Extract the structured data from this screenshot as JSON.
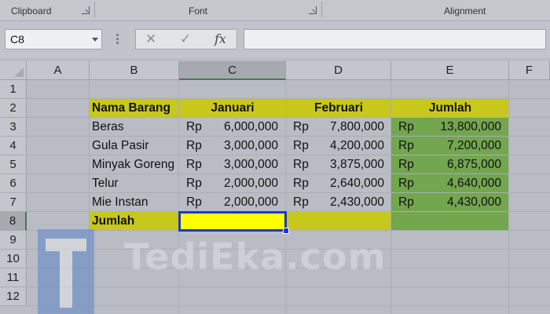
{
  "ribbon": {
    "groups": [
      {
        "label": "Clipboard"
      },
      {
        "label": "Font"
      },
      {
        "label": "Alignment"
      }
    ]
  },
  "formula_bar": {
    "name_box": "C8",
    "cancel_icon": "✕",
    "enter_icon": "✓",
    "fx_label": "fx",
    "formula": ""
  },
  "columns": [
    "A",
    "B",
    "C",
    "D",
    "E",
    "F"
  ],
  "rows": [
    "1",
    "2",
    "3",
    "4",
    "5",
    "6",
    "7",
    "8",
    "9",
    "10",
    "11",
    "12"
  ],
  "selected_cell": "C8",
  "table": {
    "headers": {
      "item": "Nama Barang",
      "jan": "Januari",
      "feb": "Februari",
      "total": "Jumlah"
    },
    "currency": "Rp",
    "rows": [
      {
        "item": "Beras",
        "jan": "6,000,000",
        "feb": "7,800,000",
        "total": "13,800,000"
      },
      {
        "item": "Gula Pasir",
        "jan": "3,000,000",
        "feb": "4,200,000",
        "total": "7,200,000"
      },
      {
        "item": "Minyak Goreng",
        "jan": "3,000,000",
        "feb": "3,875,000",
        "total": "6,875,000"
      },
      {
        "item": "Telur",
        "jan": "2,000,000",
        "feb": "2,640,000",
        "total": "4,640,000"
      },
      {
        "item": "Mie Instan",
        "jan": "2,000,000",
        "feb": "2,430,000",
        "total": "4,430,000"
      }
    ],
    "footer_label": "Jumlah"
  },
  "colors": {
    "header_fill": "#c8c81c",
    "total_fill": "#72a64f",
    "selected_fill": "#ffff00",
    "selection_border": "#1f39c9"
  },
  "watermark": {
    "text": "TediEka.com"
  }
}
